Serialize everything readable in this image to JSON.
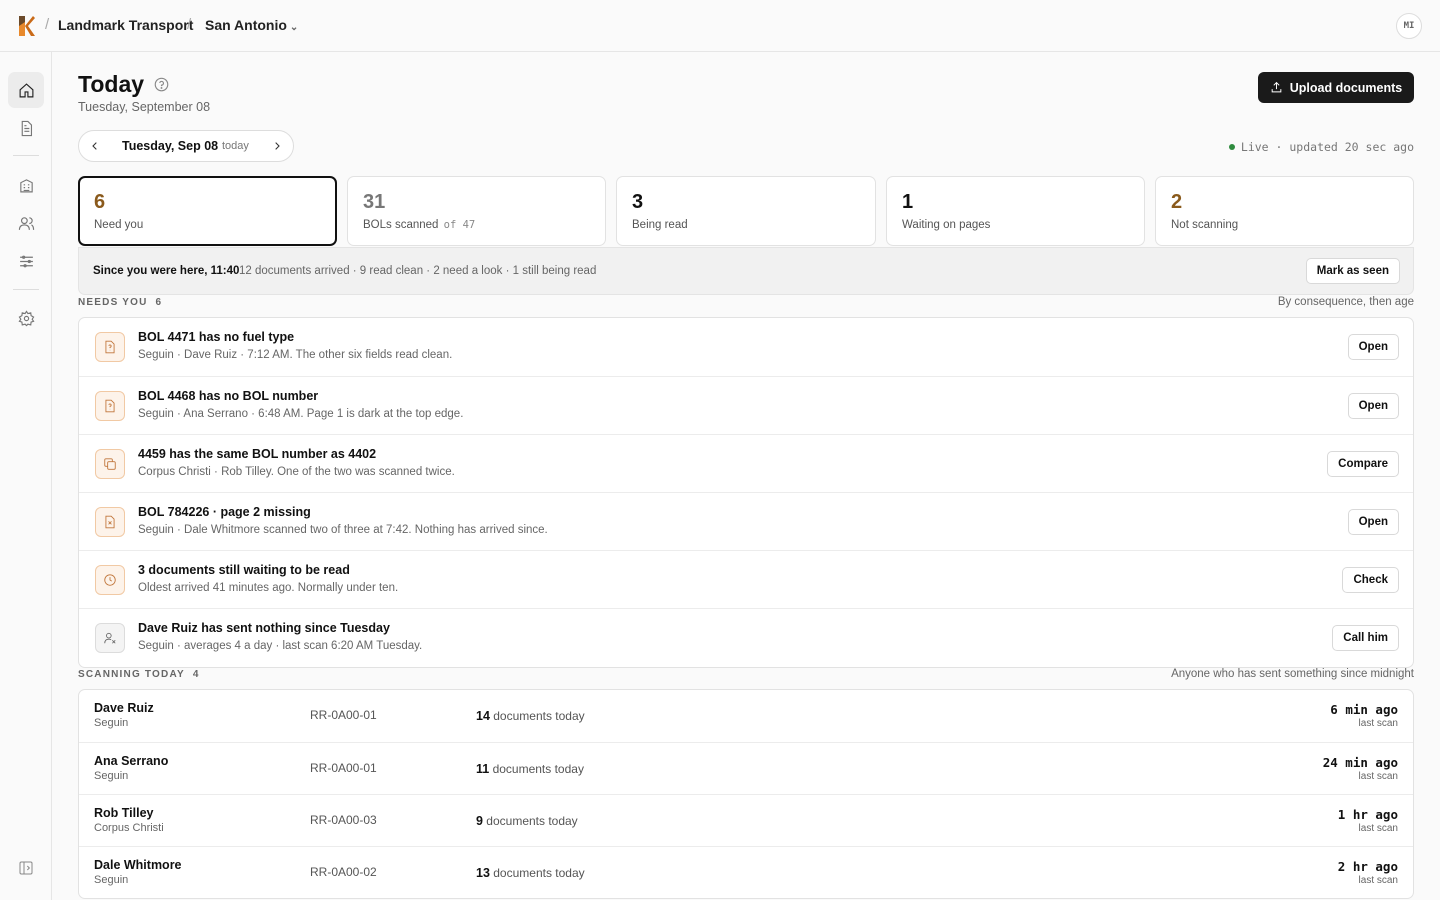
{
  "header": {
    "org": "Landmark Transport",
    "location": "San Antonio",
    "avatar_initials": "MI"
  },
  "page": {
    "title": "Today",
    "subtitle": "Tuesday, September 08",
    "upload_label": "Upload documents"
  },
  "date_nav": {
    "label": "Tuesday, Sep 08",
    "today": "today"
  },
  "live_status": "Live · updated 20 sec ago",
  "stats": [
    {
      "value": "6",
      "label": "Need you",
      "color": "#8a5a1c"
    },
    {
      "value": "31",
      "label": "BOLs scanned",
      "suffix": "of 47",
      "color": "#777777"
    },
    {
      "value": "3",
      "label": "Being read",
      "color": "#111111"
    },
    {
      "value": "1",
      "label": "Waiting on pages",
      "color": "#111111"
    },
    {
      "value": "2",
      "label": "Not scanning",
      "color": "#8a5a1c"
    }
  ],
  "since": {
    "title": "Since you were here, 11:40",
    "text": "12 documents arrived · 9 read clean · 2 need a look · 1 still being read",
    "button": "Mark as seen"
  },
  "needs": {
    "heading": "NEEDS YOU",
    "count": "6",
    "sort_note": "By consequence, then age",
    "items": [
      {
        "title": "BOL 4471 has no fuel type",
        "sub": "Seguin · Dave Ruiz · 7:12 AM. The other six fields read clean.",
        "action": "Open",
        "icon": "file-question-icon"
      },
      {
        "title": "BOL 4468 has no BOL number",
        "sub": "Seguin · Ana Serrano · 6:48 AM. Page 1 is dark at the top edge.",
        "action": "Open",
        "icon": "file-question-icon"
      },
      {
        "title": "4459 has the same BOL number as 4402",
        "sub": "Corpus Christi · Rob Tilley. One of the two was scanned twice.",
        "action": "Compare",
        "icon": "copy-icon"
      },
      {
        "title": "BOL 784226 · page 2 missing",
        "sub": "Seguin · Dale Whitmore scanned two of three at 7:42. Nothing has arrived since.",
        "action": "Open",
        "icon": "file-x-icon"
      },
      {
        "title": "3 documents still waiting to be read",
        "sub": "Oldest arrived 41 minutes ago. Normally under ten.",
        "action": "Check",
        "icon": "clock-icon"
      },
      {
        "title": "Dave Ruiz has sent nothing since Tuesday",
        "sub": "Seguin · averages 4 a day · last scan 6:20 AM Tuesday.",
        "action": "Call him",
        "icon": "user-x-icon"
      }
    ]
  },
  "scanning": {
    "heading": "SCANNING TODAY",
    "count": "4",
    "note": "Anyone who has sent something since midnight",
    "docs_suffix": "documents today",
    "ago_label": "last scan",
    "rows": [
      {
        "name": "Dave Ruiz",
        "location": "Seguin",
        "device": "RR-0A00-01",
        "docs": "14",
        "ago": "6 min ago"
      },
      {
        "name": "Ana Serrano",
        "location": "Seguin",
        "device": "RR-0A00-01",
        "docs": "11",
        "ago": "24 min ago"
      },
      {
        "name": "Rob Tilley",
        "location": "Corpus Christi",
        "device": "RR-0A00-03",
        "docs": "9",
        "ago": "1 hr ago"
      },
      {
        "name": "Dale Whitmore",
        "location": "Seguin",
        "device": "RR-0A00-02",
        "docs": "13",
        "ago": "2 hr ago"
      }
    ]
  }
}
